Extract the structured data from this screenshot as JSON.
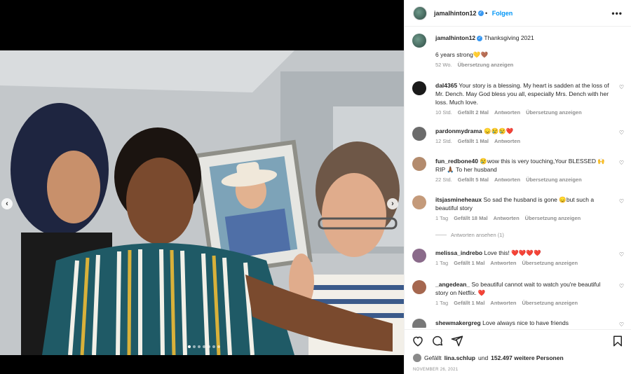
{
  "post": {
    "username": "jamalhinton12",
    "follow_label": "Folgen",
    "more_label": "•••"
  },
  "caption": {
    "username": "jamalhinton12",
    "title": "Thanksgiving 2021",
    "text": "6 years strong💛🤎",
    "time": "52 Wo.",
    "translate": "Übersetzung anzeigen"
  },
  "comments": [
    {
      "user": "dal4365",
      "text": "Your story is a blessing. My heart is sadden at the loss of Mr. Dench. May God bless you all, especially Mrs. Dench with her loss. Much love.",
      "time": "10 Std.",
      "likes": "Gefällt 2 Mal",
      "reply": "Antworten",
      "translate": "Übersetzung anzeigen",
      "avatar_color": "#1a1a1a"
    },
    {
      "user": "pardonmydrama",
      "text": "😞😢😢❤️",
      "time": "12 Std.",
      "likes": "Gefällt 1 Mal",
      "reply": "Antworten",
      "translate": "",
      "avatar_color": "#6b6b6b"
    },
    {
      "user": "fun_redbone40",
      "text": "😢wow this is very touching,Your BLESSED 🙌 RIP 🙏🏾 To her husband",
      "time": "22 Std.",
      "likes": "Gefällt 5 Mal",
      "reply": "Antworten",
      "translate": "Übersetzung anzeigen",
      "avatar_color": "#b38b6d"
    },
    {
      "user": "itsjasmineheaux",
      "text": "So sad the husband is gone 😞but such a beautiful story",
      "time": "1 Tag",
      "likes": "Gefällt 18 Mal",
      "reply": "Antworten",
      "translate": "Übersetzung anzeigen",
      "avatar_color": "#c49a7a"
    },
    {
      "user": "melissa_indrebo",
      "text": "Love this! ❤️❤️❤️❤️",
      "time": "1 Tag",
      "likes": "Gefällt 1 Mal",
      "reply": "Antworten",
      "translate": "Übersetzung anzeigen",
      "avatar_color": "#8a6a8a"
    },
    {
      "user": "_angedean_",
      "text": "So beautiful cannot wait to watch you're beautiful story on Netflix. ❤️",
      "time": "1 Tag",
      "likes": "Gefällt 1 Mal",
      "reply": "Antworten",
      "translate": "Übersetzung anzeigen",
      "avatar_color": "#a5674f"
    },
    {
      "user": "shewmakergreg",
      "text": "Love always nice to have friends",
      "time": "",
      "likes": "",
      "reply": "",
      "translate": "",
      "avatar_color": "#777777"
    }
  ],
  "view_replies": "Antworten ansehen (1)",
  "likes_line": {
    "prefix": "Gefällt",
    "user": "lina.schlup",
    "middle": "und",
    "count": "152.497 weitere Personen"
  },
  "date": "NOVEMBER 26, 2021",
  "icons": [
    "heart-icon",
    "comment-icon",
    "share-icon",
    "bookmark-icon",
    "chevron-left-icon",
    "chevron-right-icon"
  ],
  "carousel": {
    "total_slides": 7,
    "active_slide": 1
  }
}
